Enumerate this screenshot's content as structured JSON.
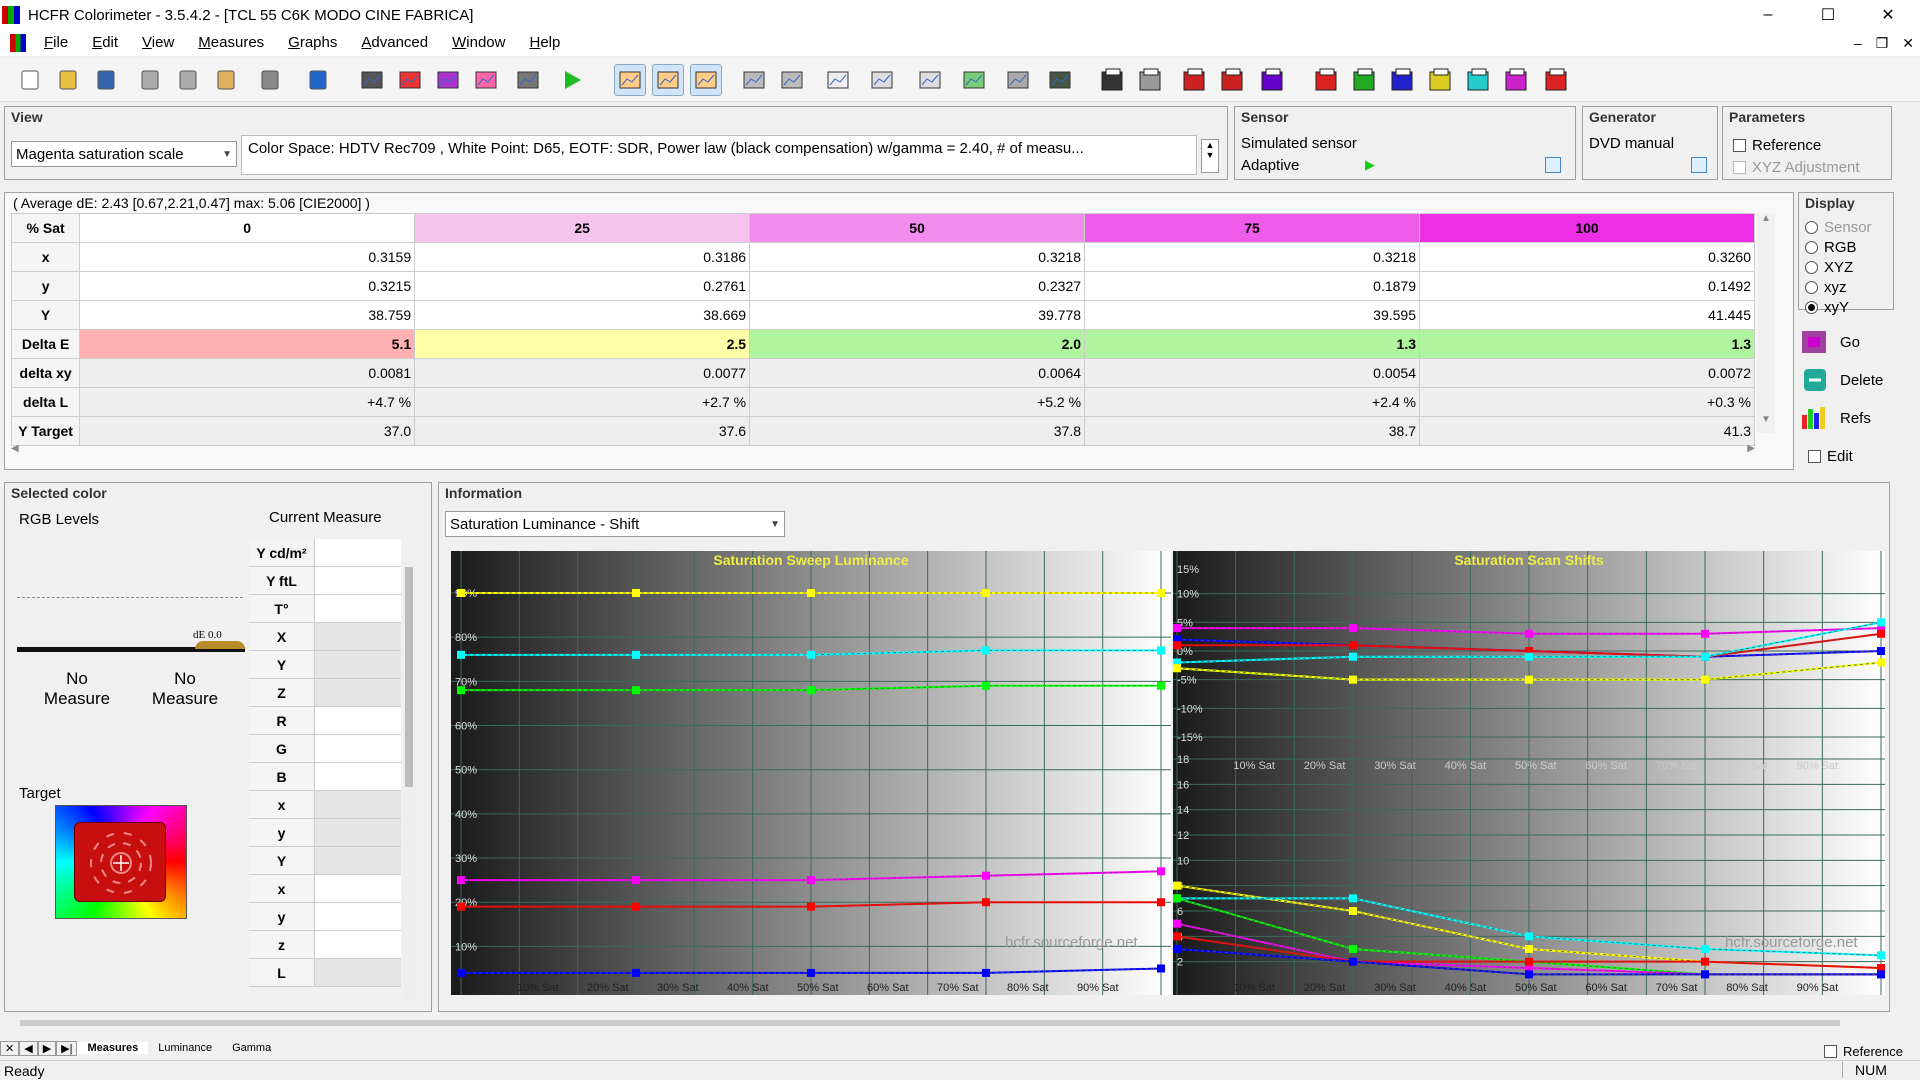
{
  "window": {
    "title": "HCFR Colorimeter - 3.5.4.2 - [TCL 55 C6K MODO CINE FABRICA]",
    "minimize": "–",
    "maximize": "☐",
    "close": "✕"
  },
  "menu": [
    "File",
    "Edit",
    "View",
    "Measures",
    "Graphs",
    "Advanced",
    "Window",
    "Help"
  ],
  "view": {
    "title": "View",
    "mode": "Magenta saturation scale",
    "info": "Color Space: HDTV Rec709 , White Point: D65, EOTF:  SDR, Power law (black compensation) w/gamma = 2.40, # of measu..."
  },
  "sensor": {
    "title": "Sensor",
    "name": "Simulated sensor",
    "mode": "Adaptive"
  },
  "generator": {
    "title": "Generator",
    "name": "DVD manual"
  },
  "parameters": {
    "title": "Parameters",
    "reference": "Reference",
    "xyz_adjustment": "XYZ Adjustment"
  },
  "summary": "( Average dE: 2.43 [0.67,2.21,0.47] max: 5.06 [CIE2000] )",
  "table": {
    "header": "% Sat",
    "columns": [
      "0",
      "25",
      "50",
      "75",
      "100"
    ],
    "column_colors": [
      "#ffffff",
      "#f4c4ee",
      "#f28cec",
      "#f05cea",
      "#ee2ee6"
    ],
    "rows": [
      {
        "label": "x",
        "values": [
          "0.3159",
          "0.3186",
          "0.3218",
          "0.3218",
          "0.3260"
        ]
      },
      {
        "label": "y",
        "values": [
          "0.3215",
          "0.2761",
          "0.2327",
          "0.1879",
          "0.1492"
        ]
      },
      {
        "label": "Y",
        "values": [
          "38.759",
          "38.669",
          "39.778",
          "39.595",
          "41.445"
        ]
      },
      {
        "label": "Delta E",
        "values": [
          "5.1",
          "2.5",
          "2.0",
          "1.3",
          "1.3"
        ],
        "colors": [
          "#ffb0b0",
          "#ffffa8",
          "#b0f4a0",
          "#b0f4a0",
          "#b0f4a0"
        ]
      },
      {
        "label": "delta xy",
        "values": [
          "0.0081",
          "0.0077",
          "0.0064",
          "0.0054",
          "0.0072"
        ]
      },
      {
        "label": "delta L",
        "values": [
          "+4.7 %",
          "+2.7 %",
          "+5.2 %",
          "+2.4 %",
          "+0.3 %"
        ]
      },
      {
        "label": "Y Target",
        "values": [
          "37.0",
          "37.6",
          "37.8",
          "38.7",
          "41.3"
        ]
      }
    ]
  },
  "display": {
    "title": "Display",
    "options": [
      {
        "label": "Sensor",
        "disabled": true
      },
      {
        "label": "RGB"
      },
      {
        "label": "XYZ"
      },
      {
        "label": "xyz"
      },
      {
        "label": "xyY",
        "selected": true
      }
    ],
    "go": "Go",
    "delete": "Delete",
    "refs": "Refs",
    "edit": "Edit"
  },
  "selected_color": {
    "title": "Selected color",
    "rgb_levels": "RGB Levels",
    "current_measure": "Current Measure",
    "de_label": "dE 0.0",
    "no_measure_1": "No\nMeasure",
    "no_measure_2": "No\nMeasure",
    "target": "Target",
    "measure_rows": [
      "Y cd/m²",
      "Y ftL",
      "T°",
      "X",
      "Y",
      "Z",
      "R",
      "G",
      "B",
      "x",
      "y",
      "Y",
      "x",
      "y",
      "z",
      "L"
    ]
  },
  "information": {
    "title": "Information",
    "graph_select": "Saturation Luminance - Shift",
    "left_chart_title": "Saturation Sweep Luminance",
    "right_chart_title": "Saturation Scan Shifts",
    "watermark": "hcfr.sourceforge.net",
    "sat_labels": [
      "10% Sat",
      "20% Sat",
      "30% Sat",
      "40% Sat",
      "50% Sat",
      "60% Sat",
      "70% Sat",
      "80% Sat",
      "90% Sat"
    ],
    "left_y_labels": [
      "90%",
      "80%",
      "70%",
      "60%",
      "50%",
      "40%",
      "30%",
      "20%",
      "10%"
    ],
    "right_top_labels": [
      "15%",
      "10%",
      "5%",
      "0%",
      "-5%",
      "-10%",
      "-15%"
    ],
    "right_bottom_labels": [
      "18",
      "16",
      "14",
      "12",
      "10",
      "8",
      "6",
      "4",
      "2"
    ]
  },
  "chart_data": [
    {
      "type": "line",
      "title": "Saturation Sweep Luminance",
      "x": [
        0,
        25,
        50,
        75,
        100
      ],
      "ylim": [
        0,
        100
      ],
      "series": [
        {
          "color": "#ffff00",
          "values": [
            91,
            91,
            91,
            91,
            91
          ]
        },
        {
          "color": "#00ffff",
          "values": [
            77,
            77,
            77,
            78,
            78
          ]
        },
        {
          "color": "#00ff00",
          "values": [
            69,
            69,
            69,
            70,
            70
          ]
        },
        {
          "color": "#ff00ff",
          "values": [
            26,
            26,
            26,
            27,
            28
          ]
        },
        {
          "color": "#ff0000",
          "values": [
            20,
            20,
            20,
            21,
            21
          ]
        },
        {
          "color": "#0000ff",
          "values": [
            5,
            5,
            5,
            5,
            6
          ]
        }
      ]
    },
    {
      "type": "line",
      "title": "Saturation Scan Shifts",
      "x": [
        0,
        25,
        50,
        75,
        100
      ],
      "ylim": [
        -15,
        15
      ],
      "series": [
        {
          "color": "#ff00ff",
          "values": [
            4,
            4,
            3,
            3,
            4
          ]
        },
        {
          "color": "#0000ff",
          "values": [
            2,
            1,
            0,
            -1,
            0
          ]
        },
        {
          "color": "#ff0000",
          "values": [
            1,
            1,
            0,
            -1,
            3
          ]
        },
        {
          "color": "#00ffff",
          "values": [
            -2,
            -1,
            -1,
            -1,
            5
          ]
        },
        {
          "color": "#00ff00",
          "values": [
            -3,
            -5,
            -5,
            -5,
            -2
          ]
        },
        {
          "color": "#ffff00",
          "values": [
            -3,
            -5,
            -5,
            -5,
            -2
          ]
        }
      ]
    },
    {
      "type": "line",
      "title": "",
      "x": [
        0,
        25,
        50,
        75,
        100
      ],
      "ylim": [
        0,
        18
      ],
      "series": [
        {
          "color": "#ffff00",
          "values": [
            8,
            6,
            3,
            2,
            1.5
          ]
        },
        {
          "color": "#00ffff",
          "values": [
            7,
            7,
            4,
            3,
            2.5
          ]
        },
        {
          "color": "#00ff00",
          "values": [
            7,
            3,
            2,
            1,
            1
          ]
        },
        {
          "color": "#ff00ff",
          "values": [
            5,
            2,
            1.5,
            1,
            1
          ]
        },
        {
          "color": "#ff0000",
          "values": [
            4,
            2,
            2,
            2,
            1.5
          ]
        },
        {
          "color": "#0000ff",
          "values": [
            3,
            2,
            1,
            1,
            1
          ]
        }
      ]
    }
  ],
  "tabs": [
    "Measures",
    "Luminance",
    "Gamma"
  ],
  "status": {
    "ready": "Ready",
    "num": "NUM",
    "reference": "Reference"
  }
}
